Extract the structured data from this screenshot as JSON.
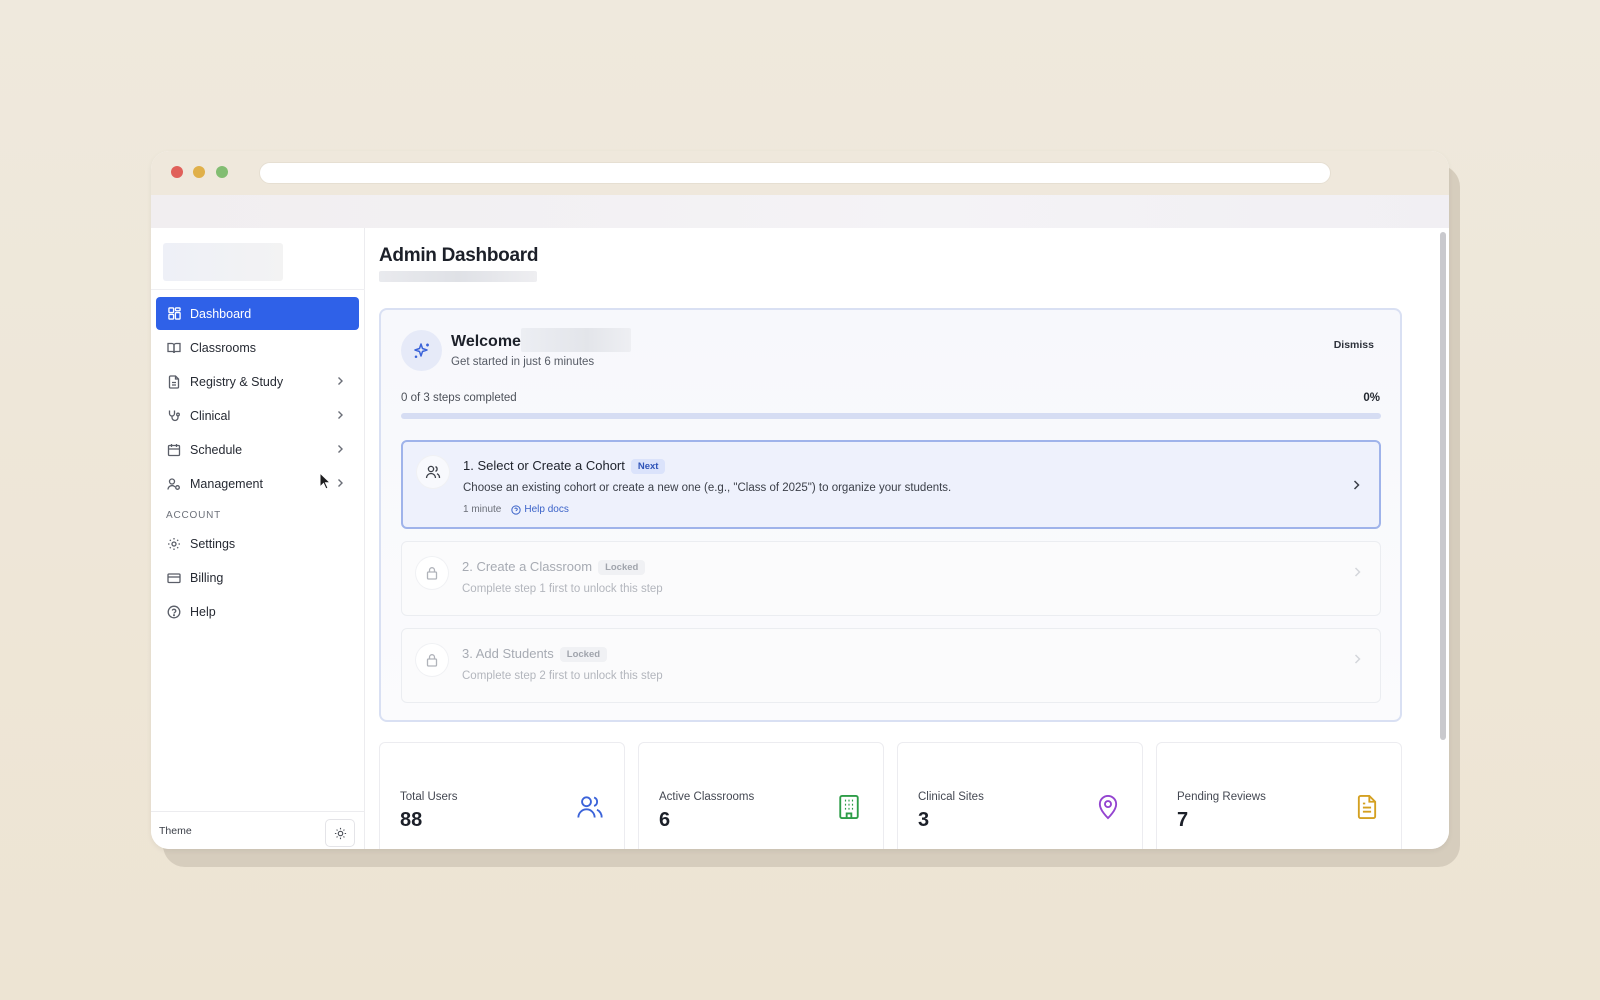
{
  "sidebar": {
    "items": [
      {
        "label": "Dashboard",
        "icon": "dashboard-grid-icon",
        "active": true
      },
      {
        "label": "Classrooms",
        "icon": "book-icon"
      },
      {
        "label": "Registry & Study",
        "icon": "document-icon",
        "has_submenu": true
      },
      {
        "label": "Clinical",
        "icon": "stethoscope-icon",
        "has_submenu": true
      },
      {
        "label": "Schedule",
        "icon": "calendar-icon",
        "has_submenu": true
      },
      {
        "label": "Management",
        "icon": "user-cog-icon",
        "has_submenu": true
      }
    ],
    "account_section": "ACCOUNT",
    "account_items": [
      {
        "label": "Settings",
        "icon": "gear-icon"
      },
      {
        "label": "Billing",
        "icon": "credit-card-icon"
      },
      {
        "label": "Help",
        "icon": "help-circle-icon"
      }
    ],
    "footer": {
      "theme_label": "Theme",
      "theme_icon": "sun-icon"
    }
  },
  "main": {
    "title": "Admin Dashboard",
    "welcome": {
      "title": "Welcome",
      "subtitle": "Get started in just 6 minutes",
      "dismiss_label": "Dismiss",
      "steps_completed": "0 of 3 steps completed",
      "percent_label": "0%",
      "progress": 0,
      "steps": [
        {
          "title": "1. Select or Create a Cohort",
          "badge": "Next",
          "description": "Choose an existing cohort or create a new one (e.g., \"Class of 2025\") to organize your students.",
          "duration": "1 minute",
          "help_label": "Help docs",
          "icon": "users-icon"
        },
        {
          "title": "2. Create a Classroom",
          "badge": "Locked",
          "description": "Complete step 1 first to unlock this step",
          "icon": "lock-icon"
        },
        {
          "title": "3. Add Students",
          "badge": "Locked",
          "description": "Complete step 2 first to unlock this step",
          "icon": "lock-icon"
        }
      ]
    },
    "stats": [
      {
        "label": "Total Users",
        "value": "88",
        "icon": "users-icon",
        "color": "#3b63d9"
      },
      {
        "label": "Active Classrooms",
        "value": "6",
        "icon": "building-icon",
        "color": "#2e9d48"
      },
      {
        "label": "Clinical Sites",
        "value": "3",
        "icon": "map-pin-icon",
        "color": "#9444d0"
      },
      {
        "label": "Pending Reviews",
        "value": "7",
        "icon": "file-text-icon",
        "color": "#d4a021"
      }
    ]
  },
  "colors": {
    "accent": "#2f61e8",
    "background": "#efe9dd"
  }
}
